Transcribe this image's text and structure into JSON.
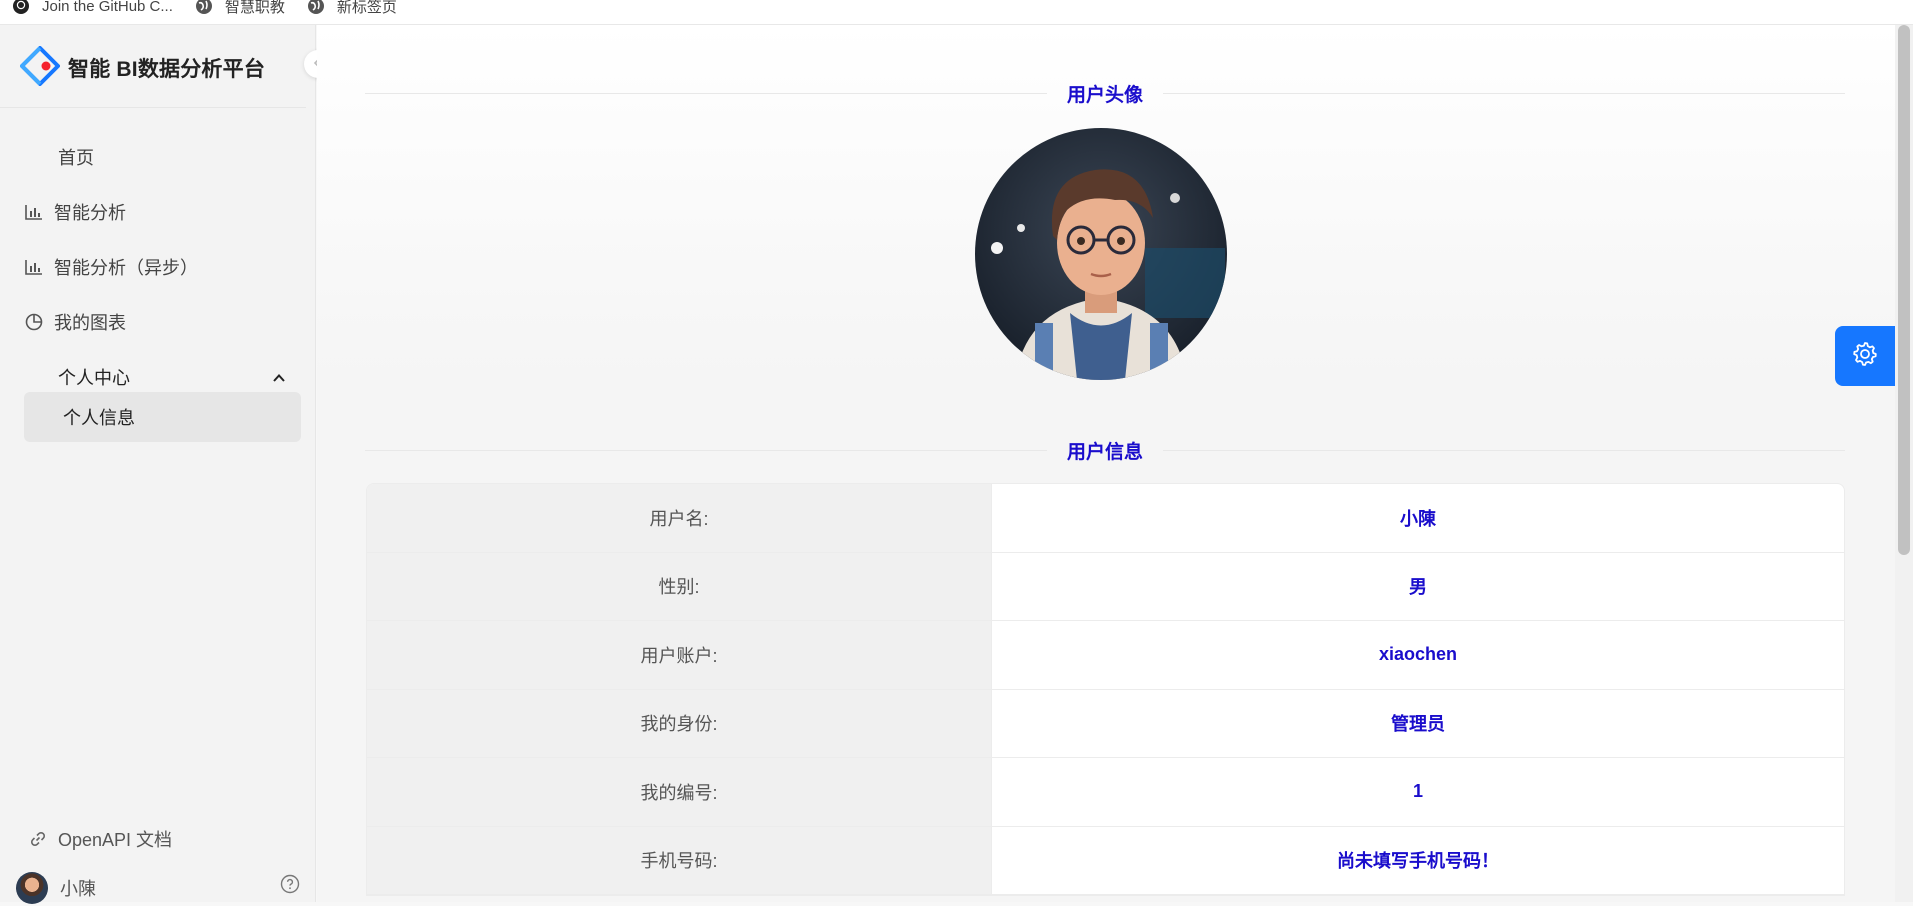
{
  "bookmarks": [
    {
      "label": "Join the GitHub C...",
      "icon": "github-icon"
    },
    {
      "label": "智慧职教",
      "icon": "globe-icon"
    },
    {
      "label": "新标签页",
      "icon": "globe-icon"
    }
  ],
  "app": {
    "title": "智能 BI数据分析平台",
    "accent": "#1677ff",
    "highlight_text_color": "#1a0dcc"
  },
  "sidebar": {
    "items": [
      {
        "label": "首页",
        "icon": null
      },
      {
        "label": "智能分析",
        "icon": "bar-chart-icon"
      },
      {
        "label": "智能分析（异步）",
        "icon": "bar-chart-icon"
      },
      {
        "label": "我的图表",
        "icon": "pie-chart-icon"
      },
      {
        "label": "个人中心",
        "icon": "chevron-up-icon",
        "expanded": true
      }
    ],
    "sub_items": [
      {
        "label": "个人信息",
        "selected": true
      }
    ],
    "openapi_label": "OpenAPI 文档",
    "user_name": "小陳"
  },
  "main": {
    "avatar_section_title": "用户头像",
    "info_section_title": "用户信息",
    "info_rows": [
      {
        "label": "用户名:",
        "value": "小陳"
      },
      {
        "label": "性别:",
        "value": "男"
      },
      {
        "label": "用户账户:",
        "value": "xiaochen"
      },
      {
        "label": "我的身份:",
        "value": "管理员"
      },
      {
        "label": "我的编号:",
        "value": "1"
      },
      {
        "label": "手机号码:",
        "value": "尚未填写手机号码！"
      }
    ]
  }
}
